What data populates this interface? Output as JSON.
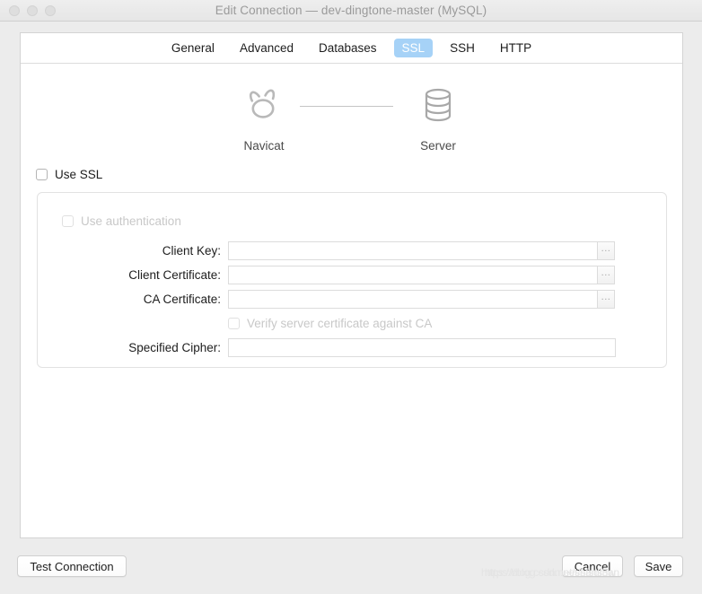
{
  "window": {
    "title": "Edit Connection — dev-dingtone-master (MySQL)",
    "traffic_lights": [
      "close",
      "minimize",
      "zoom"
    ]
  },
  "tabs": [
    {
      "label": "General",
      "selected": false
    },
    {
      "label": "Advanced",
      "selected": false
    },
    {
      "label": "Databases",
      "selected": false
    },
    {
      "label": "SSL",
      "selected": true
    },
    {
      "label": "SSH",
      "selected": false
    },
    {
      "label": "HTTP",
      "selected": false
    }
  ],
  "diagram": {
    "client": {
      "label": "Navicat",
      "icon": "navicat-logo-icon"
    },
    "server": {
      "label": "Server",
      "icon": "database-cylinder-icon"
    }
  },
  "form": {
    "use_ssl": {
      "label": "Use SSL",
      "checked": false,
      "enabled": true
    },
    "use_authentication": {
      "label": "Use authentication",
      "checked": false,
      "enabled": false
    },
    "fields": [
      {
        "label": "Client Key:",
        "value": "",
        "placeholder": "",
        "has_browse": true,
        "browse_label": "..."
      },
      {
        "label": "Client Certificate:",
        "value": "",
        "placeholder": "",
        "has_browse": true,
        "browse_label": "..."
      },
      {
        "label": "CA Certificate:",
        "value": "",
        "placeholder": "",
        "has_browse": true,
        "browse_label": "..."
      },
      {
        "label": "Specified Cipher:",
        "value": "",
        "placeholder": "",
        "has_browse": false,
        "browse_label": ""
      }
    ],
    "verify_server_certificate": {
      "label": "Verify server certificate against CA",
      "checked": false,
      "enabled": false
    }
  },
  "footer": {
    "test_connection": "Test Connection",
    "cancel": "Cancel",
    "save": "Save"
  },
  "watermark": {
    "line_a": "https://blog.csdn.net/shanshan",
    "line_b": "https://blog.csdn.net/sfsdf3w"
  },
  "colors": {
    "window_background": "#ececec",
    "panel_background": "#ffffff",
    "tab_selected_background": "#a6d2f7",
    "tab_selected_text": "#ffffff",
    "text_primary": "#1d1d1d",
    "text_disabled": "#c8c8c8",
    "title_text": "#9a9a9a",
    "border": "#d3d3d3",
    "icon_gray": "#a8a8a8"
  }
}
